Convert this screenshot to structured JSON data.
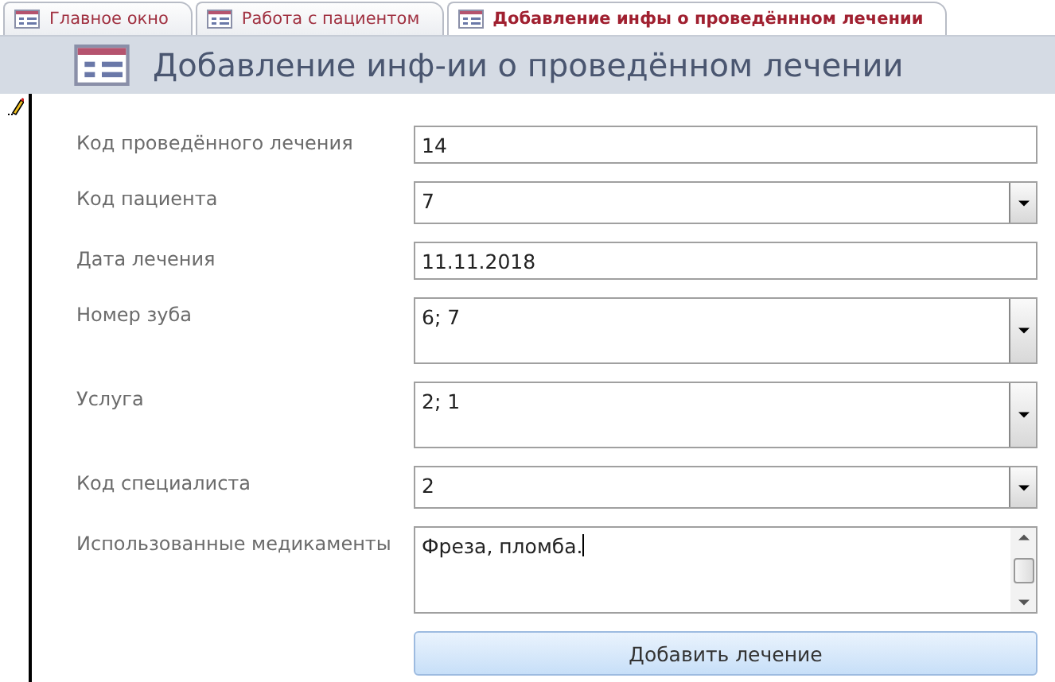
{
  "tabs": [
    {
      "label": "Главное окно",
      "selected": false
    },
    {
      "label": "Работа с пациентом",
      "selected": false
    },
    {
      "label": "Добавление инфы о проведённном лечении",
      "selected": true
    }
  ],
  "form": {
    "title": "Добавление инф-ии о проведённом лечении"
  },
  "fields": [
    {
      "label": "Код проведённого лечения",
      "value": "14",
      "kind": "text"
    },
    {
      "label": "Код пациента",
      "value": "7",
      "kind": "combo"
    },
    {
      "label": "Дата лечения",
      "value": "11.11.2018",
      "kind": "text"
    },
    {
      "label": "Номер зуба",
      "value": "6; 7",
      "kind": "multicombo"
    },
    {
      "label": "Услуга",
      "value": "2; 1",
      "kind": "multicombo"
    },
    {
      "label": "Код специалиста",
      "value": "2",
      "kind": "combo"
    },
    {
      "label": "Использованные медикаменты",
      "value": "Фреза, пломба.",
      "kind": "memo"
    }
  ],
  "button": "Добавить лечение"
}
